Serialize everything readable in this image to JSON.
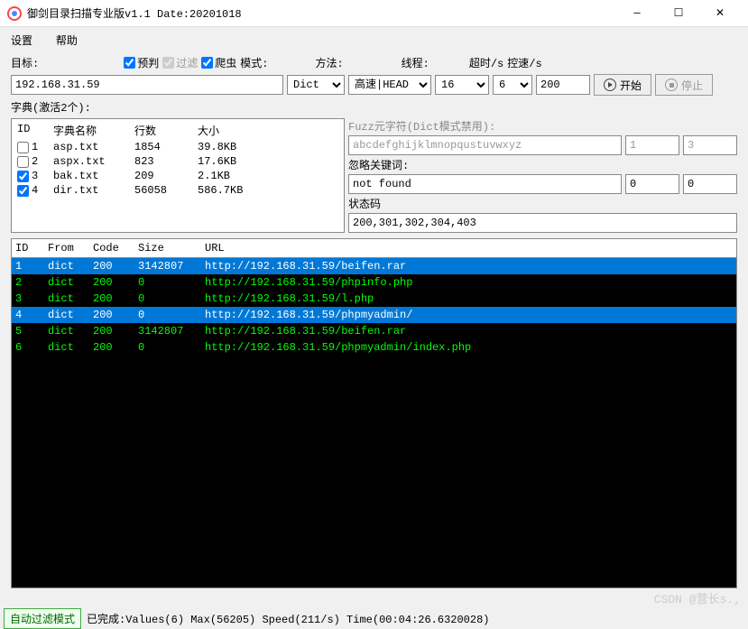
{
  "window": {
    "title": "御剑目录扫描专业版v1.1 Date:20201018"
  },
  "menu": {
    "settings": "设置",
    "help": "帮助"
  },
  "labels": {
    "target": "目标:",
    "prejudge": "预判",
    "filter": "过滤",
    "spider": "爬虫",
    "mode": "模式:",
    "method": "方法:",
    "threads": "线程:",
    "timeout": "超时/s",
    "speedlimit": "控速/s",
    "start": "开始",
    "stop": "停止",
    "dict_active": "字典(激活2个):",
    "fuzz_label": "Fuzz元字符(Dict模式禁用):",
    "ignore_keyword": "忽略关键词:",
    "status_code": "状态码"
  },
  "values": {
    "target": "192.168.31.59",
    "mode": "Dict",
    "method": "高速|HEAD",
    "threads": "16",
    "timeout": "6",
    "speedlimit": "200",
    "fuzz": "abcdefghijklmnopqustuvwxyz",
    "fuzz_n1": "1",
    "fuzz_n2": "3",
    "ignore": "not found",
    "ignore_n1": "0",
    "ignore_n2": "0",
    "status_codes": "200,301,302,304,403"
  },
  "checks": {
    "prejudge": true,
    "filter": true,
    "spider": true
  },
  "dict": {
    "headers": {
      "id": "ID",
      "name": "字典名称",
      "lines": "行数",
      "size": "大小"
    },
    "rows": [
      {
        "checked": false,
        "id": "1",
        "name": "asp.txt",
        "lines": "1854",
        "size": "39.8KB"
      },
      {
        "checked": false,
        "id": "2",
        "name": "aspx.txt",
        "lines": "823",
        "size": "17.6KB"
      },
      {
        "checked": true,
        "id": "3",
        "name": "bak.txt",
        "lines": "209",
        "size": "2.1KB"
      },
      {
        "checked": true,
        "id": "4",
        "name": "dir.txt",
        "lines": "56058",
        "size": "586.7KB"
      }
    ]
  },
  "results": {
    "headers": {
      "id": "ID",
      "from": "From",
      "code": "Code",
      "size": "Size",
      "url": "URL"
    },
    "rows": [
      {
        "id": "1",
        "from": "dict",
        "code": "200",
        "size": "3142807",
        "url": "http://192.168.31.59/beifen.rar",
        "selected": true
      },
      {
        "id": "2",
        "from": "dict",
        "code": "200",
        "size": "0",
        "url": "http://192.168.31.59/phpinfo.php",
        "selected": false
      },
      {
        "id": "3",
        "from": "dict",
        "code": "200",
        "size": "0",
        "url": "http://192.168.31.59/l.php",
        "selected": false
      },
      {
        "id": "4",
        "from": "dict",
        "code": "200",
        "size": "0",
        "url": "http://192.168.31.59/phpmyadmin/",
        "selected": true
      },
      {
        "id": "5",
        "from": "dict",
        "code": "200",
        "size": "3142807",
        "url": "http://192.168.31.59/beifen.rar",
        "selected": false
      },
      {
        "id": "6",
        "from": "dict",
        "code": "200",
        "size": "0",
        "url": "http://192.168.31.59/phpmyadmin/index.php",
        "selected": false
      }
    ]
  },
  "status": {
    "mode_btn": "自动过滤模式",
    "text": "已完成:Values(6) Max(56205) Speed(211/s) Time(00:04:26.6320028)"
  },
  "watermark": "CSDN @营长s.,"
}
